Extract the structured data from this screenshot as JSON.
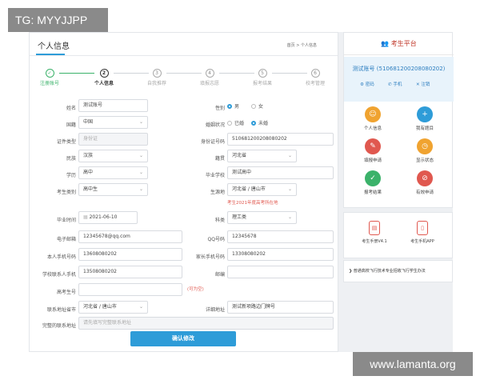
{
  "watermark_top": "TG: MYYJJPP",
  "watermark_bottom": "www.lamanta.org",
  "main": {
    "title": "个人信息",
    "breadcrumb": "首页 > 个人信息",
    "steps": [
      {
        "num": "✓",
        "label": "注册账号",
        "state": "done"
      },
      {
        "num": "2",
        "label": "个人信息",
        "state": "current"
      },
      {
        "num": "3",
        "label": "自我推荐",
        "state": "todo"
      },
      {
        "num": "4",
        "label": "填报志愿",
        "state": "todo"
      },
      {
        "num": "5",
        "label": "报考结果",
        "state": "todo"
      },
      {
        "num": "6",
        "label": "校考管理",
        "state": "todo"
      }
    ],
    "fields": {
      "name_label": "姓名",
      "name_value": "测试账号",
      "gender_label": "性别",
      "gender_male": "男",
      "gender_female": "女",
      "nation_label": "国籍",
      "nation_value": "中国",
      "marital_label": "婚姻状况",
      "marital_married": "已婚",
      "marital_single": "未婚",
      "idtype_label": "证件类型",
      "idtype_value": "身份证",
      "idnum_label": "身份证号码",
      "idnum_value": "510681200208080202",
      "ethnic_label": "民族",
      "ethnic_value": "汉族",
      "native_label": "籍贯",
      "native_value": "河北省",
      "edu_label": "学历",
      "edu_value": "高中",
      "school_label": "毕业学校",
      "school_value": "测试高中",
      "category_label": "考生类别",
      "category_value": "高中生",
      "origin_label": "生源地",
      "origin_value": "河北省 / 唐山市",
      "origin_note": "考生2021年度高考所在地",
      "gradtime_label": "毕业时间",
      "gradtime_value": "2021-06-10",
      "subject_label": "科类",
      "subject_value": "理工类",
      "email_label": "电子邮箱",
      "email_value": "12345678@qq.com",
      "qq_label": "QQ号码",
      "qq_value": "12345678",
      "mobile_label": "本人手机号码",
      "mobile_value": "13608080202",
      "parent_label": "家长手机号码",
      "parent_value": "13308080202",
      "teacher_label": "学校联系人手机",
      "teacher_value": "13508080202",
      "postcode_label": "邮编",
      "postcode_value": "",
      "examno_label": "高考生号",
      "examno_value": "",
      "examno_note": "(可为空)",
      "contact_label": "联系地址省市",
      "contact_value": "河北省 / 唐山市",
      "address_label": "详细地址",
      "address_value": "测试新项路边门牌号",
      "full_address_label": "完整的联系地址",
      "full_address_value": "请先填写完整联系地址",
      "submit_label": "确认修改"
    }
  },
  "side": {
    "header": "考生平台",
    "account": "测试账号 (510681200208080202)",
    "actions": [
      "密码",
      "手机",
      "注销"
    ],
    "grid": [
      {
        "label": "个人信息",
        "color": "#f0a330",
        "icon": "user-icon",
        "glyph": "☺"
      },
      {
        "label": "我有题目",
        "color": "#2e9cd8",
        "icon": "plus-icon",
        "glyph": "+"
      },
      {
        "label": "填报申请",
        "color": "#e0584f",
        "icon": "edit-icon",
        "glyph": "✎"
      },
      {
        "label": "显示状态",
        "color": "#f0a330",
        "icon": "clock-icon",
        "glyph": "◷"
      },
      {
        "label": "报考结果",
        "color": "#3bb26a",
        "icon": "check-icon",
        "glyph": "✓"
      },
      {
        "label": "有效申请",
        "color": "#e0584f",
        "icon": "ban-icon",
        "glyph": "⊘"
      }
    ],
    "manuals": [
      {
        "label": "考生手册V4.1",
        "icon": "manual-icon"
      },
      {
        "label": "考生手机APP",
        "icon": "phone-icon"
      }
    ],
    "link": "普通高校飞行技术专业招收飞行学生办法"
  }
}
